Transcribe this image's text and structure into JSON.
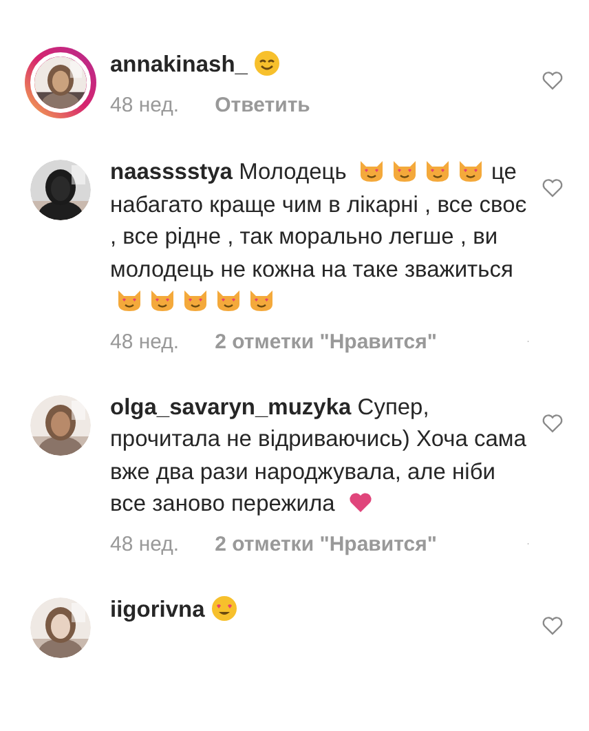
{
  "comments": [
    {
      "username": "annakinash_",
      "story_ring": true,
      "body": [
        {
          "kind": "smile"
        }
      ],
      "time": "48 нед.",
      "action": "Ответить"
    },
    {
      "username": "naasssstya",
      "story_ring": false,
      "body": [
        {
          "kind": "text",
          "text": "Молодець"
        },
        {
          "kind": "cat"
        },
        {
          "kind": "cat"
        },
        {
          "kind": "cat"
        },
        {
          "kind": "cat"
        },
        {
          "kind": "text",
          "text": "це набагато краще чим в лікарні , все своє , все рідне , так морально легше , ви молодець не кожна на таке зважиться"
        },
        {
          "kind": "cat"
        },
        {
          "kind": "cat"
        },
        {
          "kind": "cat"
        },
        {
          "kind": "cat"
        },
        {
          "kind": "cat"
        }
      ],
      "time": "48 нед.",
      "action": "2 отметки \"Нравится\"",
      "more": true
    },
    {
      "username": "olga_savaryn_muzyka",
      "story_ring": false,
      "body": [
        {
          "kind": "text",
          "text": "Супер, прочитала не відриваючись) Хоча сама вже два рази народжувала, але ніби все заново пережила"
        },
        {
          "kind": "heart"
        }
      ],
      "time": "48 нед.",
      "action": "2 отметки \"Нравится\"",
      "more": true
    },
    {
      "username": "iigorivna",
      "story_ring": false,
      "body": [
        {
          "kind": "hearteyes"
        }
      ]
    }
  ]
}
